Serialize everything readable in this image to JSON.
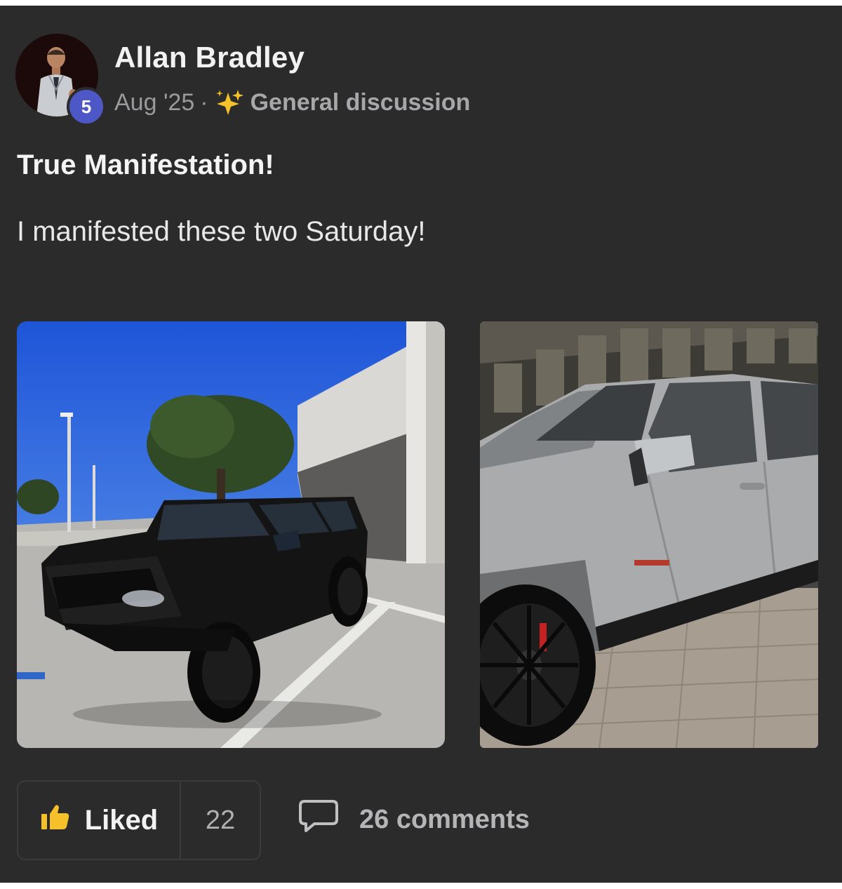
{
  "post": {
    "author": {
      "name": "Allan Bradley",
      "level": "5"
    },
    "meta": {
      "date": "Aug '25",
      "separator": "·",
      "category": "General discussion",
      "category_icon": "sparkles-icon"
    },
    "title": "True Manifestation!",
    "body": "I manifested these two Saturday!",
    "images": [
      {
        "subject": "black-suv-photo"
      },
      {
        "subject": "silver-suv-photo"
      }
    ]
  },
  "footer": {
    "like_label": "Liked",
    "like_icon": "thumbs-up-icon",
    "like_count": "22",
    "comments_label": "26 comments",
    "comments_icon": "comment-bubble-icon"
  },
  "colors": {
    "card_background": "#2b2b2c",
    "level_badge": "#4d57c6",
    "like_accent": "#f5c02a"
  }
}
